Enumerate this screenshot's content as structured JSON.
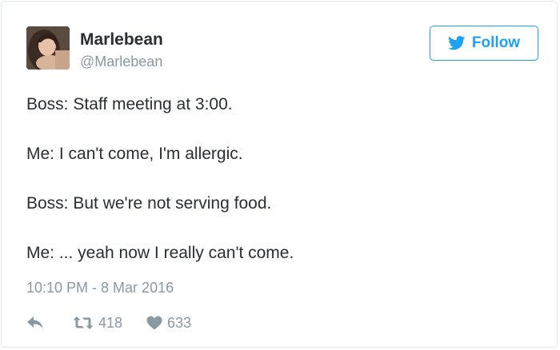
{
  "author": {
    "display_name": "Marlebean",
    "username": "@Marlebean"
  },
  "follow_button": {
    "label": "Follow",
    "icon": "twitter-bird-icon"
  },
  "tweet": {
    "lines": [
      "Boss: Staff meeting at 3:00.",
      "Me: I can't come, I'm allergic.",
      "Boss: But we're not serving food.",
      "Me: ... yeah now I really can't come."
    ],
    "timestamp": "10:10 PM - 8 Mar 2016"
  },
  "actions": {
    "reply_icon": "reply-icon",
    "retweet_icon": "retweet-icon",
    "retweet_count": "418",
    "like_icon": "heart-icon",
    "like_count": "633"
  },
  "colors": {
    "accent": "#1da1f2",
    "text": "#292f33",
    "muted": "#8899a6",
    "border": "#e1e8ed"
  }
}
